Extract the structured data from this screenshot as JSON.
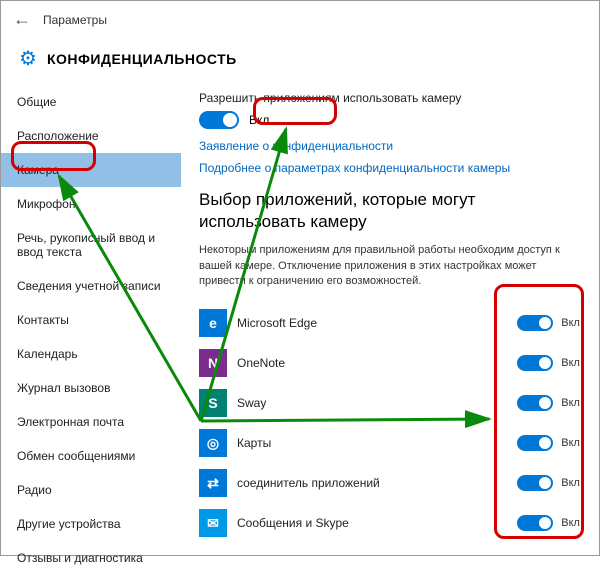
{
  "header": {
    "back": "←",
    "title": "Параметры"
  },
  "page_title": "КОНФИДЕНЦИАЛЬНОСТЬ",
  "sidebar": {
    "items": [
      {
        "label": "Общие"
      },
      {
        "label": "Расположение"
      },
      {
        "label": "Камера",
        "active": true
      },
      {
        "label": "Микрофон"
      },
      {
        "label": "Речь, рукописный ввод и ввод текста"
      },
      {
        "label": "Сведения учетной записи"
      },
      {
        "label": "Контакты"
      },
      {
        "label": "Календарь"
      },
      {
        "label": "Журнал вызовов"
      },
      {
        "label": "Электронная почта"
      },
      {
        "label": "Обмен сообщениями"
      },
      {
        "label": "Радио"
      },
      {
        "label": "Другие устройства"
      },
      {
        "label": "Отзывы и диагностика"
      }
    ]
  },
  "main": {
    "allow_label": "Разрешить приложениям использовать камеру",
    "master_toggle": "Вкл.",
    "link1": "Заявление о конфиденциальности",
    "link2": "Подробнее о параметрах конфиденциальности камеры",
    "section_title": "Выбор приложений, которые могут использовать камеру",
    "section_desc": "Некоторым приложениям для правильной работы необходим доступ к вашей камере. Отключение приложения в этих настройках может привести к ограничению его возможностей.",
    "apps": [
      {
        "name": "Microsoft Edge",
        "state": "Вкл.",
        "bg": "#0078d7",
        "glyph": "e"
      },
      {
        "name": "OneNote",
        "state": "Вкл.",
        "bg": "#7b2d8e",
        "glyph": "N"
      },
      {
        "name": "Sway",
        "state": "Вкл.",
        "bg": "#008272",
        "glyph": "S"
      },
      {
        "name": "Карты",
        "state": "Вкл.",
        "bg": "#0078d7",
        "glyph": "◎"
      },
      {
        "name": "соединитель приложений",
        "state": "Вкл.",
        "bg": "#0078d7",
        "glyph": "⇄"
      },
      {
        "name": "Сообщения и Skype",
        "state": "Вкл.",
        "bg": "#0099e5",
        "glyph": "✉"
      }
    ]
  }
}
